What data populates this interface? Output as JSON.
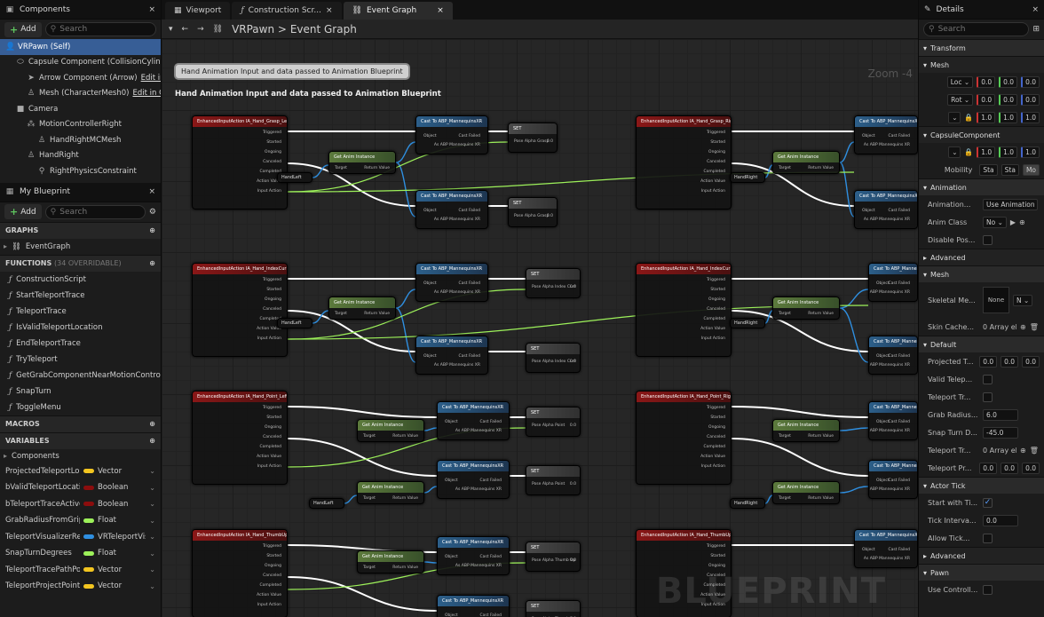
{
  "components_panel": {
    "tab": "Components",
    "add_label": "Add",
    "search_placeholder": "Search",
    "tree": [
      {
        "label": "VRPawn (Self)",
        "indent": 0
      },
      {
        "label": "Capsule Component (CollisionCylinder)",
        "indent": 1
      },
      {
        "label": "Arrow Component (Arrow)",
        "edit": "Edit in C++",
        "indent": 2
      },
      {
        "label": "Mesh (CharacterMesh0)",
        "edit": "Edit in C++",
        "indent": 2
      },
      {
        "label": "Camera",
        "indent": 1
      },
      {
        "label": "MotionControllerRight",
        "indent": 2
      },
      {
        "label": "HandRightMCMesh",
        "indent": 3
      },
      {
        "label": "HandRight",
        "indent": 2
      },
      {
        "label": "RightPhysicsConstraint",
        "indent": 3
      }
    ]
  },
  "my_blueprint": {
    "tab": "My Blueprint",
    "add_label": "Add",
    "search_placeholder": "Search",
    "graphs_label": "GRAPHS",
    "graphs": [
      "EventGraph"
    ],
    "functions_label": "FUNCTIONS",
    "functions_count": "(34 OVERRIDABLE)",
    "functions": [
      "ConstructionScript",
      "StartTeleportTrace",
      "TeleportTrace",
      "IsValidTeleportLocation",
      "EndTeleportTrace",
      "TryTeleport",
      "GetGrabComponentNearMotionController",
      "SnapTurn",
      "ToggleMenu"
    ],
    "macros_label": "MACROS",
    "variables_label": "VARIABLES",
    "components_group": "Components",
    "variables": [
      {
        "name": "ProjectedTeleportLocation",
        "type": "Vector",
        "color": "#f3c520"
      },
      {
        "name": "bValidTeleportLocation",
        "type": "Boolean",
        "color": "#8c0d0d"
      },
      {
        "name": "bTeleportTraceActive",
        "type": "Boolean",
        "color": "#8c0d0d"
      },
      {
        "name": "GrabRadiusFromGripPosition",
        "type": "Float",
        "color": "#9df15a"
      },
      {
        "name": "TeleportVisualizerReference",
        "type": "VRTeleportVisualizer",
        "color": "#2f8fe0"
      },
      {
        "name": "SnapTurnDegrees",
        "type": "Float",
        "color": "#9df15a"
      },
      {
        "name": "TeleportTracePathPoints",
        "type": "Vector",
        "color": "#f3c520"
      },
      {
        "name": "TeleportProjectPointToNavigation",
        "type": "Vector",
        "color": "#f3c520"
      }
    ]
  },
  "editor": {
    "tabs": [
      "Viewport",
      "Construction Scr...",
      "Event Graph"
    ],
    "breadcrumb_root": "VRPawn",
    "breadcrumb_sep": ">",
    "breadcrumb_leaf": "Event Graph",
    "zoom": "Zoom -4",
    "comment_bubble": "Hand Animation Input and data passed to Animation Blueprint",
    "comment_title": "Hand Animation Input and data passed to Animation Blueprint",
    "watermark": "BLUEPRINT",
    "nodes": [
      {
        "id": "n1",
        "kind": "red",
        "title": "EnhancedInputAction IA_Hand_Grasp_Left"
      },
      {
        "id": "n2",
        "kind": "blue",
        "title": "Cast To ABP_MannequinsXR"
      },
      {
        "id": "n3",
        "kind": "grey",
        "title": "SET"
      },
      {
        "id": "n4",
        "kind": "blue",
        "title": "Cast To ABP_MannequinsXR"
      },
      {
        "id": "n5",
        "kind": "grey",
        "title": "SET"
      },
      {
        "id": "n6",
        "kind": "red",
        "title": "EnhancedInputAction IA_Hand_Grasp_Right"
      },
      {
        "id": "n7",
        "kind": "blue",
        "title": "Cast To ABP_MannequinsXR"
      },
      {
        "id": "n8",
        "kind": "blue",
        "title": "Cast To ABP_MannequinsXR"
      },
      {
        "id": "n9",
        "kind": "red",
        "title": "EnhancedInputAction IA_Hand_IndexCurl_Left"
      },
      {
        "id": "n10",
        "kind": "blue",
        "title": "Cast To ABP_MannequinsXR"
      },
      {
        "id": "n11",
        "kind": "grey",
        "title": "SET"
      },
      {
        "id": "n12",
        "kind": "blue",
        "title": "Cast To ABP_MannequinsXR"
      },
      {
        "id": "n13",
        "kind": "grey",
        "title": "SET"
      },
      {
        "id": "n14",
        "kind": "red",
        "title": "EnhancedInputAction IA_Hand_IndexCurl_Right"
      },
      {
        "id": "n15",
        "kind": "blue",
        "title": "Cast To ABP_MannequinsXR"
      },
      {
        "id": "n16",
        "kind": "blue",
        "title": "Cast To ABP_MannequinsXR"
      },
      {
        "id": "n17",
        "kind": "red",
        "title": "EnhancedInputAction IA_Hand_Point_Left"
      },
      {
        "id": "n18",
        "kind": "blue",
        "title": "Cast To ABP_MannequinsXR"
      },
      {
        "id": "n19",
        "kind": "grey",
        "title": "SET"
      },
      {
        "id": "n20",
        "kind": "blue",
        "title": "Cast To ABP_MannequinsXR"
      },
      {
        "id": "n21",
        "kind": "grey",
        "title": "SET"
      },
      {
        "id": "n22",
        "kind": "red",
        "title": "EnhancedInputAction IA_Hand_Point_Right"
      },
      {
        "id": "n23",
        "kind": "blue",
        "title": "Cast To ABP_MannequinsXR"
      },
      {
        "id": "n24",
        "kind": "blue",
        "title": "Cast To ABP_MannequinsXR"
      },
      {
        "id": "n25",
        "kind": "red",
        "title": "EnhancedInputAction IA_Hand_ThumbUp_Left"
      },
      {
        "id": "n26",
        "kind": "blue",
        "title": "Cast To ABP_MannequinsXR"
      },
      {
        "id": "n27",
        "kind": "grey",
        "title": "SET"
      },
      {
        "id": "n28",
        "kind": "blue",
        "title": "Cast To ABP_MannequinsXR"
      },
      {
        "id": "n29",
        "kind": "grey",
        "title": "SET"
      },
      {
        "id": "n30",
        "kind": "red",
        "title": "EnhancedInputAction IA_Hand_ThumbUp_Right"
      },
      {
        "id": "n31",
        "kind": "blue",
        "title": "Cast To ABP_MannequinsXR"
      },
      {
        "id": "n32",
        "kind": "green",
        "title": "Get Anim Instance"
      },
      {
        "id": "n33",
        "kind": "green",
        "title": "Get Anim Instance"
      },
      {
        "id": "n34",
        "kind": "green",
        "title": "Get Anim Instance"
      },
      {
        "id": "n35",
        "kind": "green",
        "title": "Get Anim Instance"
      },
      {
        "id": "n36",
        "kind": "green",
        "title": "Get Anim Instance"
      },
      {
        "id": "n37",
        "kind": "green",
        "title": "Get Anim Instance"
      },
      {
        "id": "n38",
        "kind": "green",
        "title": "Get Anim Instance"
      },
      {
        "id": "n39",
        "kind": "green",
        "title": "Get Anim Instance"
      },
      {
        "id": "n40",
        "kind": "green",
        "title": "Get Anim Instance"
      }
    ],
    "pin_labels": {
      "event": [
        "Triggered",
        "Started",
        "Ongoing",
        "Canceled",
        "Completed",
        "Action Value",
        "Input Action"
      ],
      "cast": [
        "Object",
        "Cast Failed",
        "As ABP Mannequins XR"
      ],
      "get_anim": [
        "Target",
        "Return Value"
      ],
      "var_left": "HandLeft",
      "var_right": "HandRight",
      "set_grasp": "Pose Alpha Grasp",
      "set_index": "Pose Alpha Index Curl",
      "set_point": "Pose Alpha Point",
      "set_thumb": "Pose Alpha Thumb Up",
      "set_val": "0.0"
    }
  },
  "details": {
    "tab": "Details",
    "search_placeholder": "Search",
    "transform": "Transform",
    "mesh_section": "Mesh",
    "loc": "Loc",
    "rot": "Rot",
    "loc_vals": [
      "0.0",
      "0.0",
      "0.0"
    ],
    "rot_vals": [
      "0.0",
      "0.0",
      "0.0"
    ],
    "scale_vals": [
      "1.0",
      "1.0",
      "1.0"
    ],
    "capsule": "CapsuleComponent",
    "capsule_vals": [
      "1.0",
      "1.0",
      "1.0"
    ],
    "mobility_label": "Mobility",
    "mobility_opts": [
      "Sta",
      "Sta",
      "Mo"
    ],
    "animation": "Animation",
    "anim_mode_label": "Animation...",
    "anim_mode_val": "Use Animation Blueprint",
    "anim_class_label": "Anim Class",
    "anim_class_val": "No",
    "disable_post_label": "Disable Pos...",
    "advanced": "Advanced",
    "mesh2": "Mesh",
    "skel_label": "Skeletal Me...",
    "skel_val": "None",
    "skel_sel": "N",
    "skin_label": "Skin Cache...",
    "skin_val": "0 Array elements",
    "default": "Default",
    "proj_label": "Projected T...",
    "proj_vals": [
      "0.0",
      "0.0",
      "0.0"
    ],
    "valid_label": "Valid Telep...",
    "ttrace_label": "Teleport Tr...",
    "grab_label": "Grab Radius...",
    "grab_val": "6.0",
    "snap_label": "Snap Turn D...",
    "snap_val": "-45.0",
    "ttrace2_label": "Teleport Tr...",
    "ttrace2_val": "0 Array elements",
    "tproj_label": "Teleport Pr...",
    "tproj_vals": [
      "0.0",
      "0.0",
      "0.0"
    ],
    "actor_tick": "Actor Tick",
    "start_tick_label": "Start with Ti...",
    "tick_int_label": "Tick Interva...",
    "tick_int_val": "0.0",
    "allow_tick_label": "Allow Tick...",
    "advanced2": "Advanced",
    "pawn": "Pawn",
    "use_ctrl_label": "Use Controll..."
  },
  "colors": {
    "accent": "#375e96",
    "event_header": "#8a1717",
    "cast_header": "#2c5f8a",
    "exec_wire": "#ffffff",
    "float_wire": "#9df15a",
    "object_wire": "#2f8fe0"
  }
}
